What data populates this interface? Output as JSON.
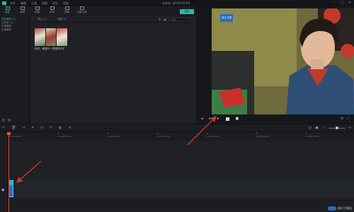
{
  "menubar": {
    "items": [
      "文件",
      "编辑",
      "工具",
      "视图",
      "导出",
      "帮助"
    ],
    "time": "未命名: 00:00:07:00"
  },
  "window_controls": {
    "minimize": "–",
    "maximize": "□",
    "close": "✕"
  },
  "toolbar": {
    "tools": [
      "媒体",
      "音频",
      "标题",
      "转场",
      "效果",
      "分屏元素"
    ],
    "export_label": "导出"
  },
  "sidebar": {
    "items": [
      "项目媒体 (1)",
      "文件夹 (1)",
      "共享媒体",
      "示例媒体"
    ]
  },
  "media": {
    "import_label": "导入",
    "record_label": "录制",
    "search_placeholder": "搜索",
    "clip_name": "杨洋、焦国丹一李园的时光"
  },
  "preview": {
    "channel_logo": "浙江卫视",
    "colors": {
      "accent": "#2fb7a5",
      "playhead": "#e0523a",
      "clip": "#2b72c7",
      "arrow": "#d9332b"
    }
  },
  "timeline": {
    "ruler_ticks": [
      "00:00:00:00",
      "00:00:05:00",
      "00:00:10:00",
      "00:00:15:00",
      "00:00:20:00",
      "00:00:25:00",
      "00:00:30:00",
      "00:00:35:00"
    ]
  },
  "watermark": {
    "text": "极光下载站"
  }
}
